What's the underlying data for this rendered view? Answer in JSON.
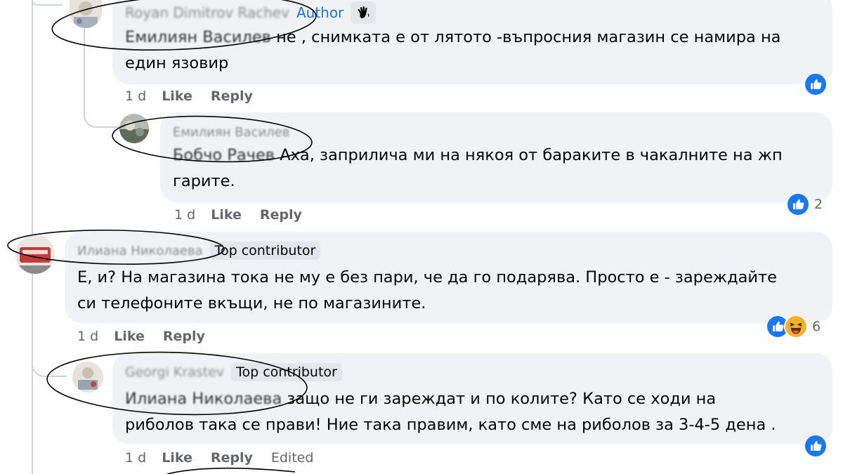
{
  "comments": [
    {
      "author": "Royan Dimitrov Rachev",
      "badge": "Author",
      "badge_icon": "waving-hand-icon",
      "mention": "Емилиян Василев",
      "text_line1": " не , снимката е от лятото -въпросния магазин се намира на",
      "text_line2": "един язовир",
      "time": "1 d",
      "like": "Like",
      "reply": "Reply",
      "reactions": [
        "like"
      ]
    },
    {
      "author": "Емилиян Василев",
      "mention": "Бобчо Рачев",
      "text_line1": " Аха, заприлича ми на някоя от бараките в чакалните на жп",
      "text_line2": "гарите.",
      "time": "1 d",
      "like": "Like",
      "reply": "Reply",
      "reactions": [
        "like"
      ],
      "reaction_count": "2"
    },
    {
      "author": "Илиана Николаева",
      "badge": "Top contributor",
      "text_line1": "Е, и? На магазина тока не му е без пари, че да го подарява. Просто е - зареждайте",
      "text_line2": "си телефоните вкъщи, не по магазините.",
      "time": "1 d",
      "like": "Like",
      "reply": "Reply",
      "reactions": [
        "like",
        "haha"
      ],
      "reaction_count": "6"
    },
    {
      "author": "Georgi Krastev",
      "badge": "Top contributor",
      "mention": "Илиана Николаева",
      "text_line1": " защо не ги зареждат и по колите? Като се ходи на",
      "text_line2": "риболов така се прави! Ние така правим, като сме на риболов за 3-4-5 дена .",
      "time": "1 d",
      "like": "Like",
      "reply": "Reply",
      "edited": "Edited",
      "reactions": [
        "like"
      ]
    }
  ],
  "colors": {
    "bubble": "#f0f2f5",
    "meta": "#65676b",
    "author_badge": "#1b74e4",
    "like_blue": "#1877f2",
    "haha_yellow": "#f7b125"
  }
}
